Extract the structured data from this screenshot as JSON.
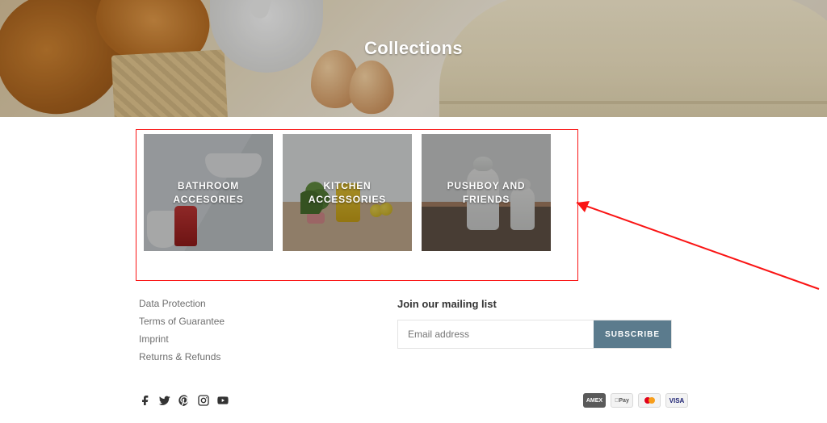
{
  "hero": {
    "title": "Collections"
  },
  "collections": [
    {
      "label": "BATHROOM ACCESORIES",
      "slug": "bathroom-accessories"
    },
    {
      "label": "KITCHEN ACCESSORIES",
      "slug": "kitchen-accessories"
    },
    {
      "label": "PUSHBOY AND FRIENDS",
      "slug": "pushboy-and-friends"
    }
  ],
  "footer_links": [
    "Data Protection",
    "Terms of Guarantee",
    "Imprint",
    "Returns & Refunds"
  ],
  "newsletter": {
    "heading": "Join our mailing list",
    "placeholder": "Email address",
    "button": "SUBSCRIBE"
  },
  "socials": [
    "facebook",
    "twitter",
    "pinterest",
    "instagram",
    "youtube"
  ],
  "payments": [
    "amex",
    "apple-pay",
    "mastercard",
    "visa"
  ]
}
